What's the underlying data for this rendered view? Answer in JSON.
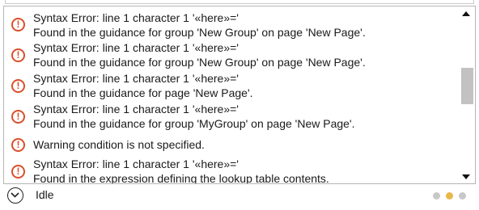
{
  "messages": [
    {
      "line1": "Syntax Error: line 1 character 1 '«here»='",
      "line2": "Found in the guidance for group 'New Group' on page 'New Page'."
    },
    {
      "line1": "Syntax Error: line 1 character 1 '«here»='",
      "line2": "Found in the guidance for group 'New Group' on page 'New Page'."
    },
    {
      "line1": "Syntax Error: line 1 character 1 '«here»='",
      "line2": "Found in the guidance for page 'New Page'."
    },
    {
      "line1": "Syntax Error: line 1 character 1 '«here»='",
      "line2": "Found in the guidance for group 'MyGroup' on page 'New Page'."
    },
    {
      "line1": "Warning condition is not specified."
    },
    {
      "line1": "Syntax Error: line 1 character 1 '«here»='",
      "line2": "Found in the expression defining the lookup table contents."
    }
  ],
  "status": {
    "text": "Idle"
  },
  "colors": {
    "warning": "#d9502b",
    "scroll_thumb": "#c2c2c2",
    "dot_1": "#c8c8c8",
    "dot_2": "#e8b84a",
    "dot_3": "#c8c8c8"
  },
  "icons": {
    "warning": "exclamation-circle-icon",
    "toggle": "chevron-down-icon"
  }
}
